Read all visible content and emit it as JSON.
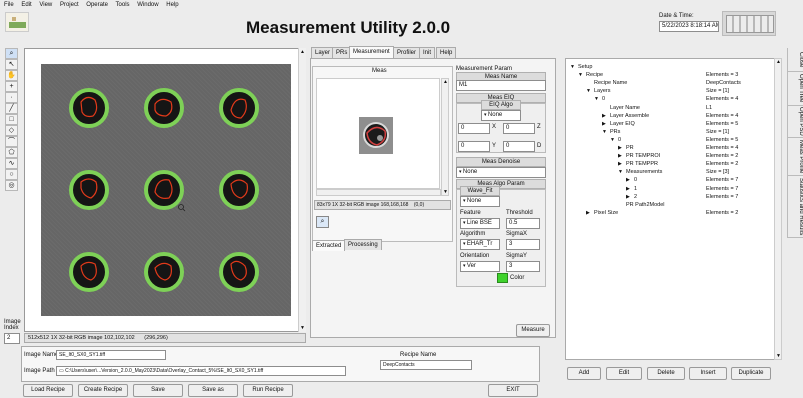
{
  "menu": [
    "File",
    "Edit",
    "View",
    "Project",
    "Operate",
    "Tools",
    "Window",
    "Help"
  ],
  "app_title": "Measurement Utility 2.0.0",
  "datetime": {
    "label": "Date & Time:",
    "value": "5/22/2023 8:18:14 AM"
  },
  "image_index": {
    "label": "Image\nIndex",
    "value": "2"
  },
  "image_info": {
    "desc": "512x512 1X 32-bit RGB image 102,102,102",
    "coords": "(296,296)"
  },
  "tabs": [
    "Layer",
    "PRs",
    "Measurement",
    "Profiler",
    "Init",
    "Help"
  ],
  "meas_panel": {
    "title": "Meas",
    "image_info": "83x79 1X 32-bit RGB image 168,168,168",
    "coords": "(0,0)",
    "subtabs": [
      "Extracted",
      "Processing"
    ]
  },
  "param": {
    "section_title": "Measurement Param",
    "meas_name_label": "Meas Name",
    "meas_name_value": "M1",
    "eiq_label": "Meas EIQ",
    "eiq_algo_label": "EIQ Algo",
    "eiq_algo_value": "None",
    "x_value": "0",
    "x_label": "X",
    "z_value": "0",
    "z_label": "Z",
    "y_value": "0",
    "y_label": "Y",
    "d_value": "0",
    "d_label": "D",
    "denoise_label": "Meas Denoise",
    "denoise_value": "None",
    "algo_param_label": "Meas Algo Param",
    "wave_fit_label": "Wave_Fit",
    "wave_fit_value": "None",
    "feature_label": "Feature",
    "feature_value": "Line BSE",
    "threshold_label": "Threshold",
    "threshold_value": "0.5",
    "algorithm_label": "Algorithm",
    "algorithm_value": "EHAR_Tr",
    "sigmax_label": "SigmaX",
    "sigmax_value": "3",
    "orientation_label": "Orientation",
    "orientation_value": "Ver",
    "sigmay_label": "SigmaY",
    "sigmay_value": "3",
    "color_label": "Color",
    "color_value": "#3fd22c",
    "measure_button": "Measure"
  },
  "tree": [
    {
      "indent": 0,
      "arrow": "down",
      "name": "Setup",
      "value": ""
    },
    {
      "indent": 1,
      "arrow": "down",
      "name": "Recipe",
      "value": "Elements = 3"
    },
    {
      "indent": 2,
      "arrow": "",
      "name": "Recipe Name",
      "value": "DeepContacts"
    },
    {
      "indent": 2,
      "arrow": "down",
      "name": "Layers",
      "value": "Size = [1]"
    },
    {
      "indent": 3,
      "arrow": "down",
      "name": "0",
      "value": "Elements = 4"
    },
    {
      "indent": 4,
      "arrow": "",
      "name": "Layer Name",
      "value": "L1"
    },
    {
      "indent": 4,
      "arrow": "right",
      "name": "Layer Assemble",
      "value": "Elements = 4"
    },
    {
      "indent": 4,
      "arrow": "right",
      "name": "Layer EIQ",
      "value": "Elements = 5"
    },
    {
      "indent": 4,
      "arrow": "down",
      "name": "PRs",
      "value": "Size = [1]"
    },
    {
      "indent": 5,
      "arrow": "down",
      "name": "0",
      "value": "Elements = 5"
    },
    {
      "indent": 6,
      "arrow": "right",
      "name": "PR",
      "value": "Elements = 4"
    },
    {
      "indent": 6,
      "arrow": "right",
      "name": "PR TEMPROI",
      "value": "Elements = 2"
    },
    {
      "indent": 6,
      "arrow": "right",
      "name": "PR TEMPPR",
      "value": "Elements = 2"
    },
    {
      "indent": 6,
      "arrow": "down",
      "name": "Measurements",
      "value": "Size = [3]"
    },
    {
      "indent": 7,
      "arrow": "right",
      "name": "0",
      "value": "Elements = 7"
    },
    {
      "indent": 7,
      "arrow": "right",
      "name": "1",
      "value": "Elements = 7"
    },
    {
      "indent": 7,
      "arrow": "right",
      "name": "2",
      "value": "Elements = 7"
    },
    {
      "indent": 6,
      "arrow": "",
      "name": "PR Path2Model",
      "value": ""
    },
    {
      "indent": 2,
      "arrow": "right",
      "name": "Pixel Size",
      "value": "Elements = 2"
    }
  ],
  "tree_buttons": [
    "Add",
    "Edit",
    "Delete",
    "Insert",
    "Duplicate"
  ],
  "side_tabs": [
    "Close",
    "Open Tree",
    "Open PSD",
    "Meas Profile",
    "Statistics and Results"
  ],
  "image_name": {
    "label": "Image Name",
    "value": "SE_It0_SX0_SY1.tiff"
  },
  "image_path": {
    "label": "Image Path",
    "value": "C:\\Users\\user\\...Version_2.0.0_May2023\\Data\\Overlay_Contact_5%\\SE_It0_SX0_SY1.tiff"
  },
  "recipe_name": {
    "label": "Recipe Name",
    "value": "DeepContacts"
  },
  "bottom_buttons": [
    "Load Recipe",
    "Create Recipe",
    "Save",
    "Save as",
    "Run Recipe",
    "EXIT"
  ],
  "colors": {
    "accent_green": "#3fd22c",
    "contour_red": "#e23a1a",
    "ring_green": "#7ed157",
    "background_gray": "#666666"
  }
}
